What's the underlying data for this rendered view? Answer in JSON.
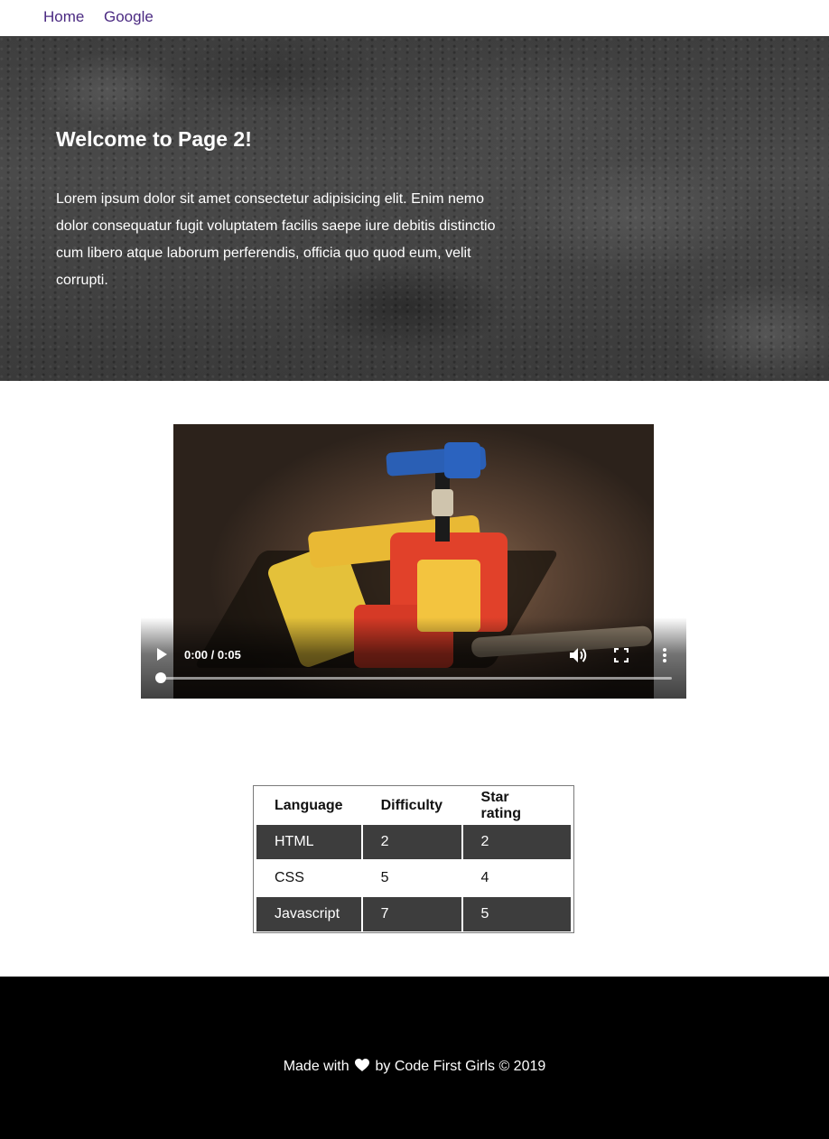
{
  "nav": {
    "links": [
      {
        "label": "Home"
      },
      {
        "label": "Google"
      }
    ],
    "link_color": "#4b2a82"
  },
  "hero": {
    "title": "Welcome to Page 2!",
    "body": "Lorem ipsum dolor sit amet consectetur adipisicing elit. Enim nemo dolor consequatur fugit voluptatem facilis saepe iure debitis distinctio cum libero atque laborum perferendis, officia quo quod eum, velit corrupti."
  },
  "video": {
    "time": "0:00 / 0:05",
    "progress": 0,
    "icons": [
      "play-icon",
      "volume-icon",
      "fullscreen-icon",
      "more-options-icon"
    ]
  },
  "table": {
    "headers": [
      "Language",
      "Difficulty",
      "Star rating"
    ],
    "rows": [
      [
        "HTML",
        "2",
        "2"
      ],
      [
        "CSS",
        "5",
        "4"
      ],
      [
        "Javascript",
        "7",
        "5"
      ]
    ]
  },
  "footer": {
    "text_before": "Made with",
    "heart_icon": "heart-icon",
    "text_after": "by Code First Girls © 2019"
  }
}
